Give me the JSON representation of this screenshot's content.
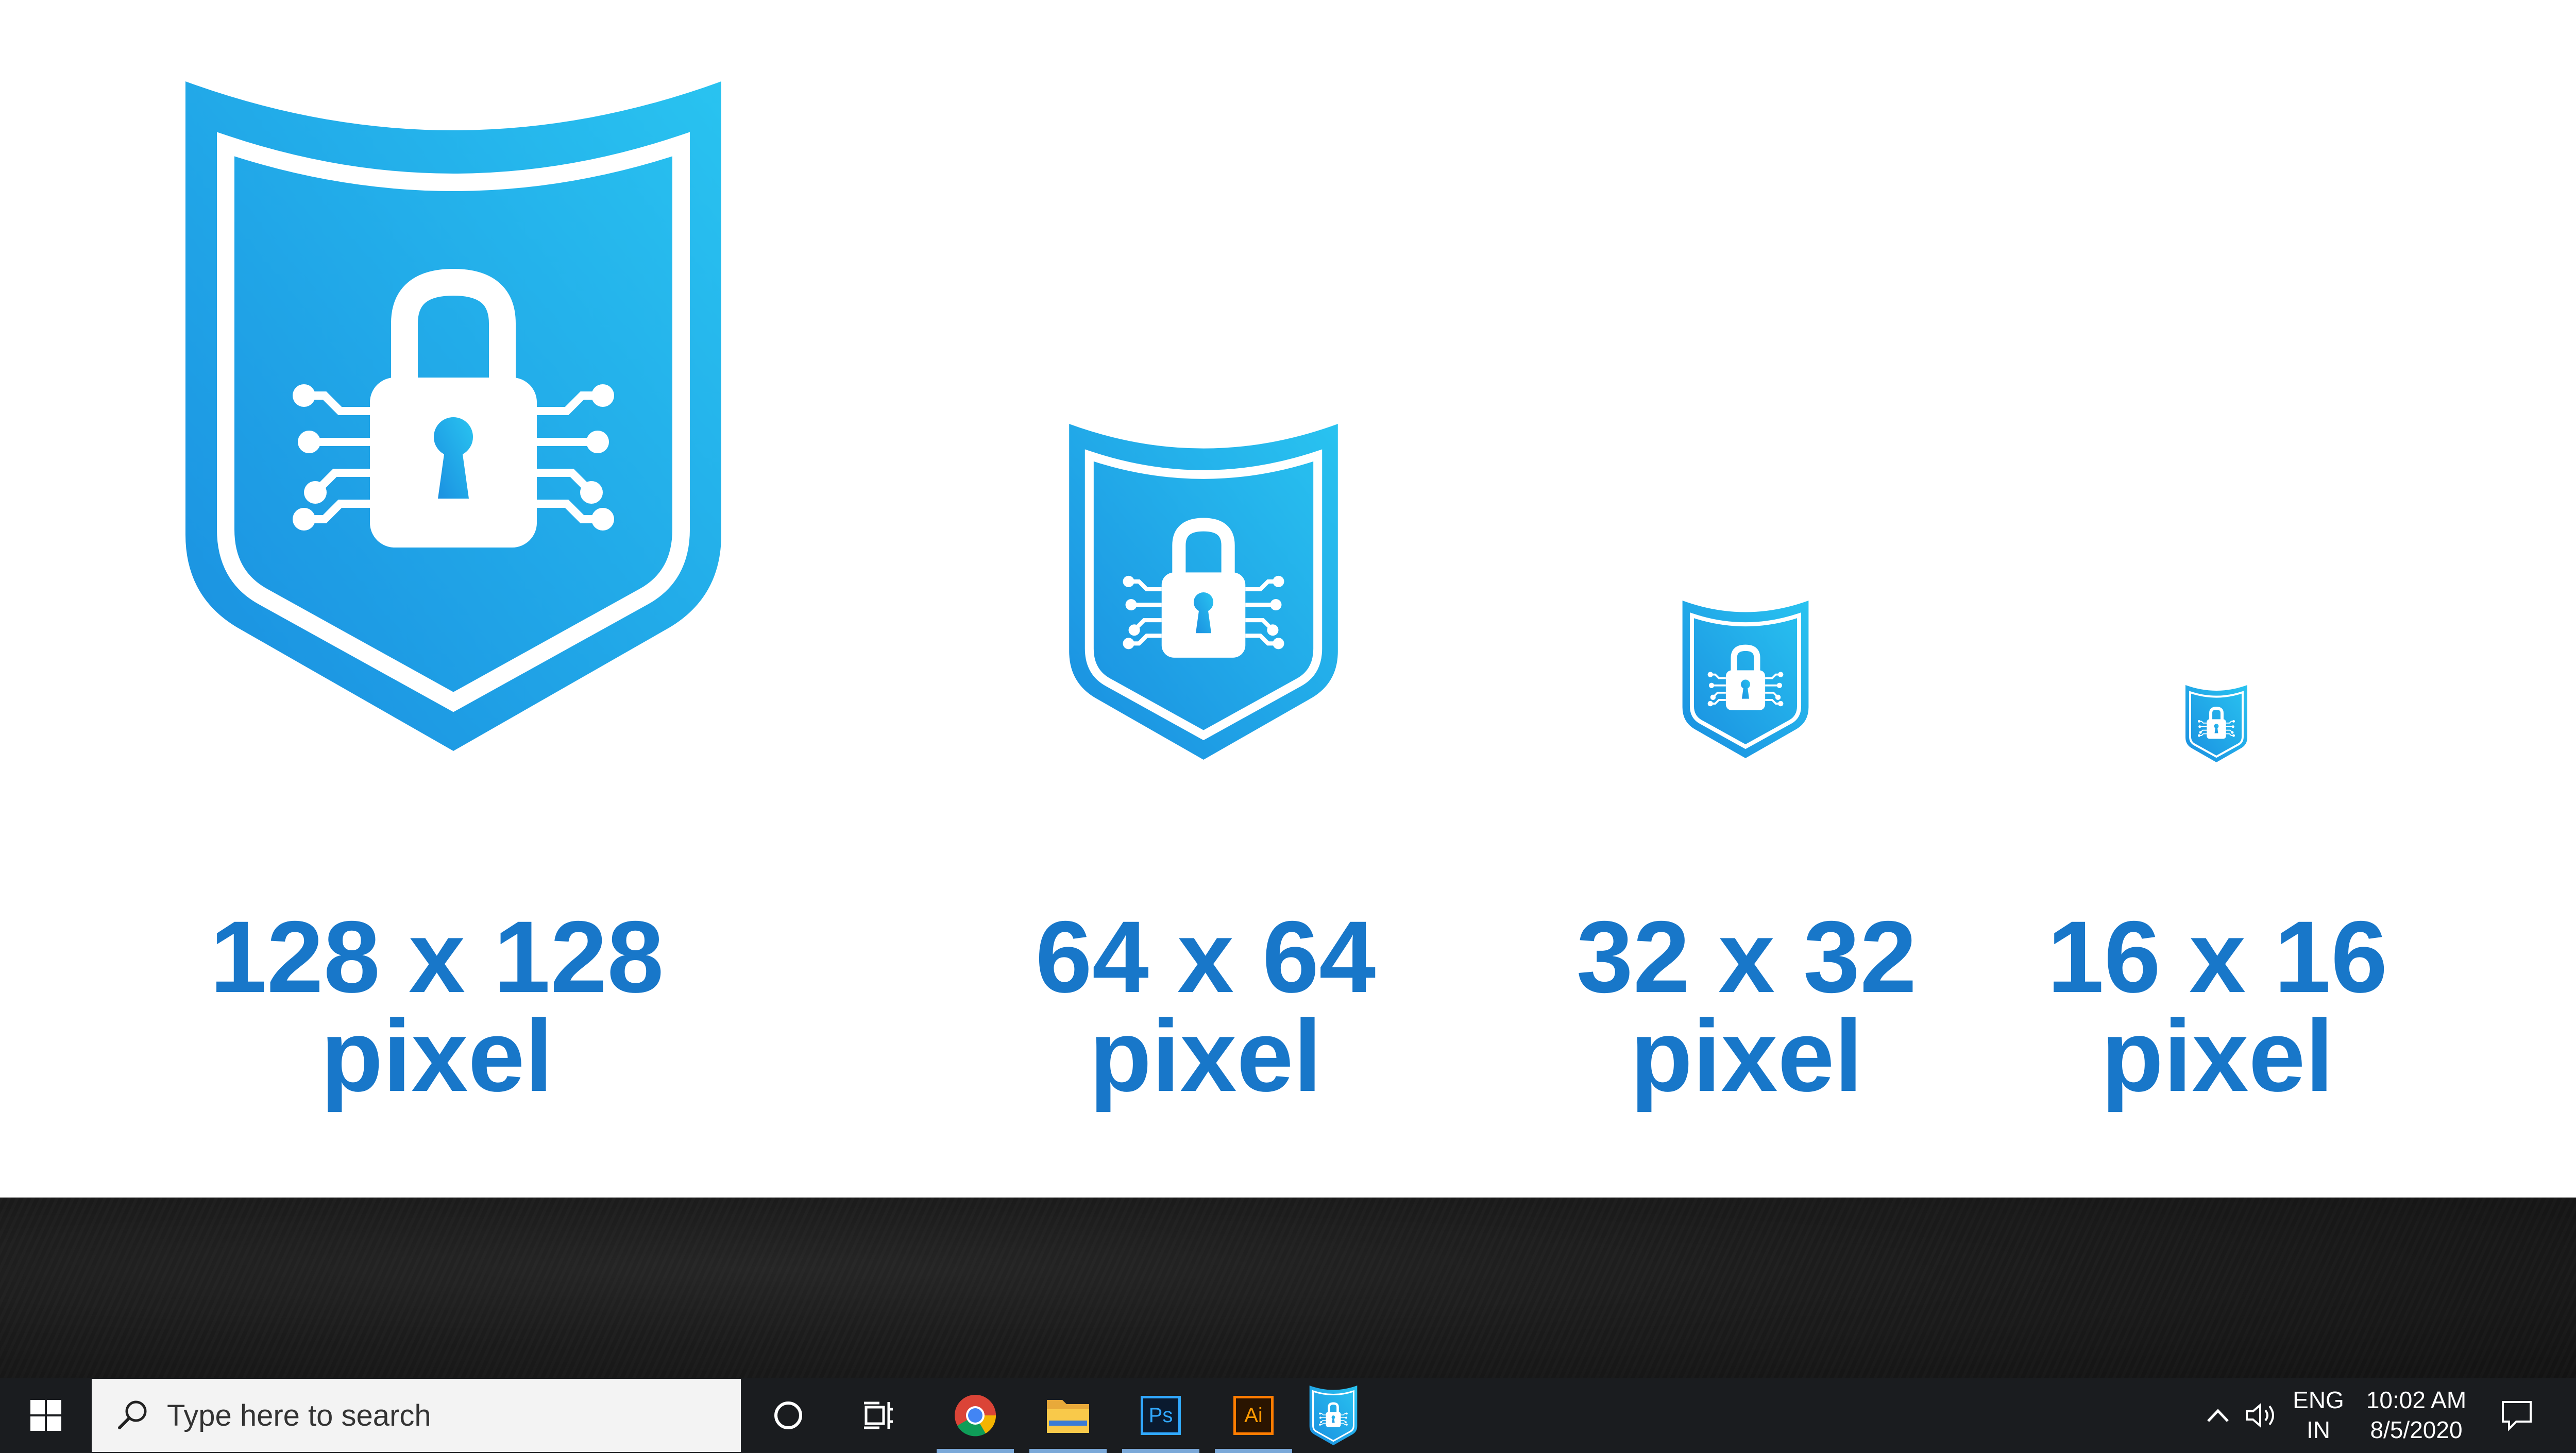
{
  "sizes": [
    {
      "dimension": "128 x 128",
      "unit": "pixel"
    },
    {
      "dimension": "64 x 64",
      "unit": "pixel"
    },
    {
      "dimension": "32 x 32",
      "unit": "pixel"
    },
    {
      "dimension": "16 x 16",
      "unit": "pixel"
    }
  ],
  "colors": {
    "brand_blue": "#1877c9",
    "shield_light": "#29c3f0",
    "shield_dark": "#1a8ee0",
    "taskbar": "#1a1c1f"
  },
  "taskbar": {
    "search_placeholder": "Type here to search",
    "pinned_apps": [
      "cortana-circle",
      "task-view",
      "chrome",
      "file-explorer",
      "photoshop",
      "illustrator",
      "shield-lock-app"
    ],
    "photoshop_label": "Ps",
    "illustrator_label": "Ai",
    "language_top": "ENG",
    "language_bottom": "IN",
    "time": "10:02 AM",
    "date": "8/5/2020"
  }
}
